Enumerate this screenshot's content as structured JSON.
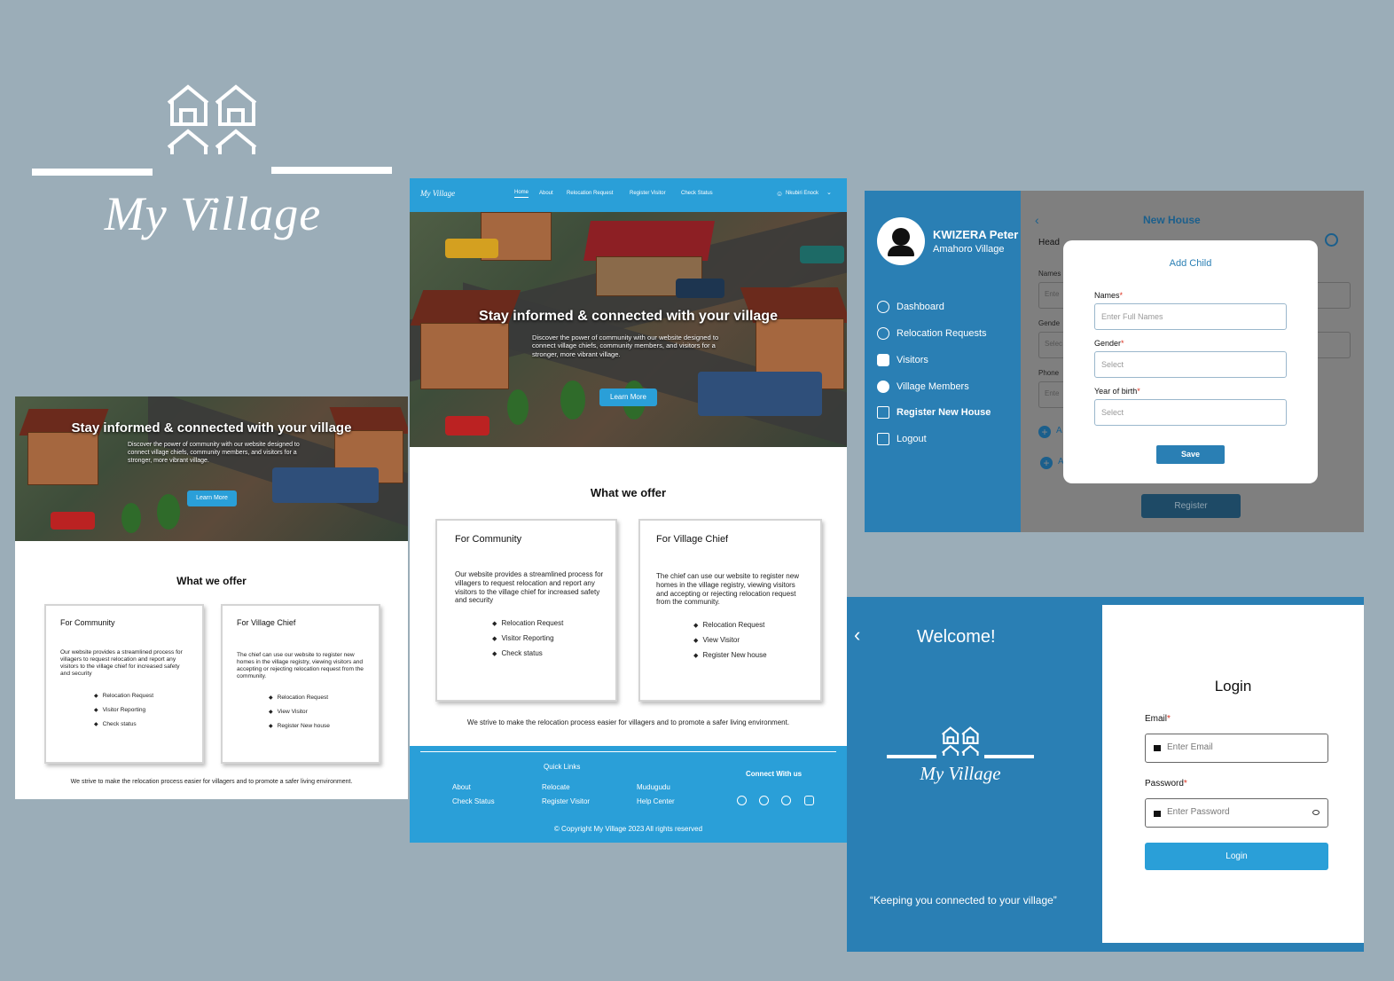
{
  "logo": {
    "text": "My Village"
  },
  "nav": {
    "brand": "My Village",
    "items": [
      "Home",
      "About",
      "Relocation Request",
      "Register Visitor",
      "Check Status"
    ],
    "user": "Nkubiri Enock"
  },
  "hero": {
    "title": "Stay informed & connected with your village",
    "subtitle": "Discover the power of community with our website designed to connect village chiefs, community members, and visitors for a stronger, more vibrant village.",
    "button": "Learn More"
  },
  "offer": {
    "heading": "What we offer",
    "community": {
      "title": "For Community",
      "text": "Our website provides a streamlined process for villagers to request relocation and report any visitors to the village chief for increased safety and security",
      "items": [
        "Relocation Request",
        "Visitor Reporting",
        "Check status"
      ]
    },
    "chief": {
      "title": "For Village Chief",
      "text": "The chief can use our website to register new homes in the village registry, viewing visitors and accepting  or rejecting relocation request from the community.",
      "items": [
        "Relocation Request",
        "View Visitor",
        "Register New house"
      ]
    },
    "tagline": "We strive to make the relocation process easier for villagers and to promote a safer living environment."
  },
  "footer": {
    "quick_links": "Quick Links",
    "links": [
      "About",
      "Check Status",
      "Relocate",
      "Register Visitor",
      "Mudugudu",
      "Help Center"
    ],
    "connect": "Connect  With  us",
    "copyright": "© Copyright My Village 2023 All rights reserved"
  },
  "dash": {
    "user": "KWIZERA Peter",
    "village": "Amahoro Village",
    "menu": [
      "Dashboard",
      "Relocation  Requests",
      "Visitors",
      "Village Members",
      "Register New House",
      "Logout"
    ],
    "page_title": "New House",
    "head_label": "Head",
    "names_label": "Names",
    "gender_label": "Gende",
    "phone_label": "Phone",
    "enter_short": "Ente",
    "select_short": "Selec",
    "add_short": "A",
    "register": "Register",
    "modal": {
      "title": "Add Child",
      "names": "Names",
      "names_ph": "Enter Full Names",
      "gender": "Gender",
      "gender_ph": "Select",
      "year": "Year of birth",
      "year_ph": "Select",
      "save": "Save"
    }
  },
  "login": {
    "welcome": "Welcome!",
    "brand": "My Village",
    "quote": "“Keeping you connected to your village”",
    "title": "Login",
    "email_label": "Email",
    "email_ph": "Enter Email",
    "password_label": "Password",
    "password_ph": "Enter Password",
    "button": "Login"
  },
  "colors": {
    "bg": "#9badb8",
    "primary": "#2a9fd8",
    "sidebar": "#2a7fb4",
    "dark_btn": "#1b5f8c"
  }
}
